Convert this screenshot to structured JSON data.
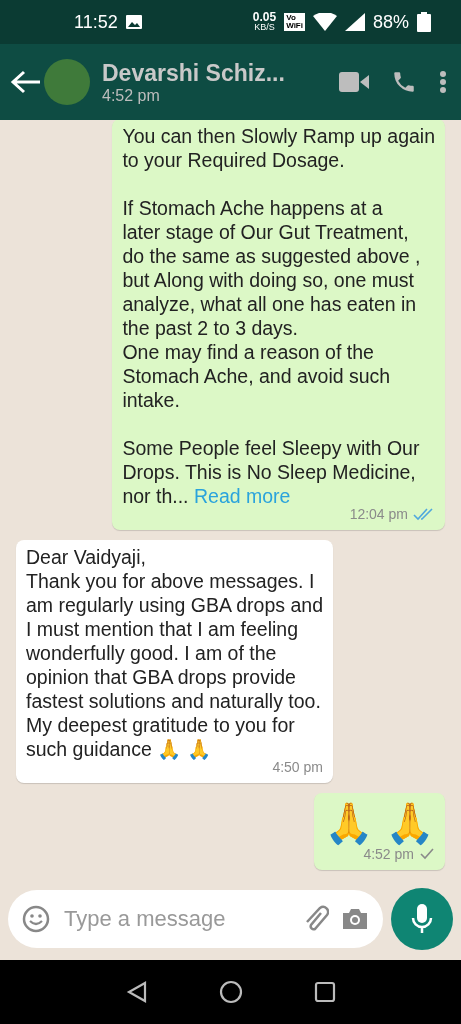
{
  "status_bar": {
    "time": "11:52",
    "network_speed": "0.05",
    "network_unit": "KB/S",
    "volte": "Vo\nWiFi",
    "battery": "88%"
  },
  "header": {
    "contact_name": "Devarshi Schiz...",
    "last_seen": "4:52 pm"
  },
  "messages": [
    {
      "outgoing": true,
      "text": "You can then Slowly Ramp up again\nto your Required Dosage.\n\nIf Stomach Ache happens at a\nlater stage of Our Gut Treatment,\ndo the same as suggested above ,\nbut Along with doing so, one must\nanalyze, what all one has eaten in\nthe past 2 to 3 days.\nOne may find a reason of the\nStomach Ache, and avoid such\nintake.\n\nSome People feel Sleepy with Our\nDrops. This is No Sleep Medicine,\nnor th...",
      "read_more": "Read more",
      "time": "12:04 pm",
      "read": true
    },
    {
      "outgoing": false,
      "text": "Dear Vaidyaji,\nThank you for above messages. I\nam regularly using GBA drops and\nI must mention that I am feeling\nwonderfully good. I am of the\nopinion that GBA drops provide\nfastest solutions and naturally too.\nMy deepest gratitude to you for\nsuch guidance 🙏 🙏",
      "time": "4:50 pm"
    },
    {
      "outgoing": true,
      "text": "🙏 🙏",
      "time": "4:52 pm",
      "read": false
    }
  ],
  "composer": {
    "placeholder": "Type a message"
  }
}
